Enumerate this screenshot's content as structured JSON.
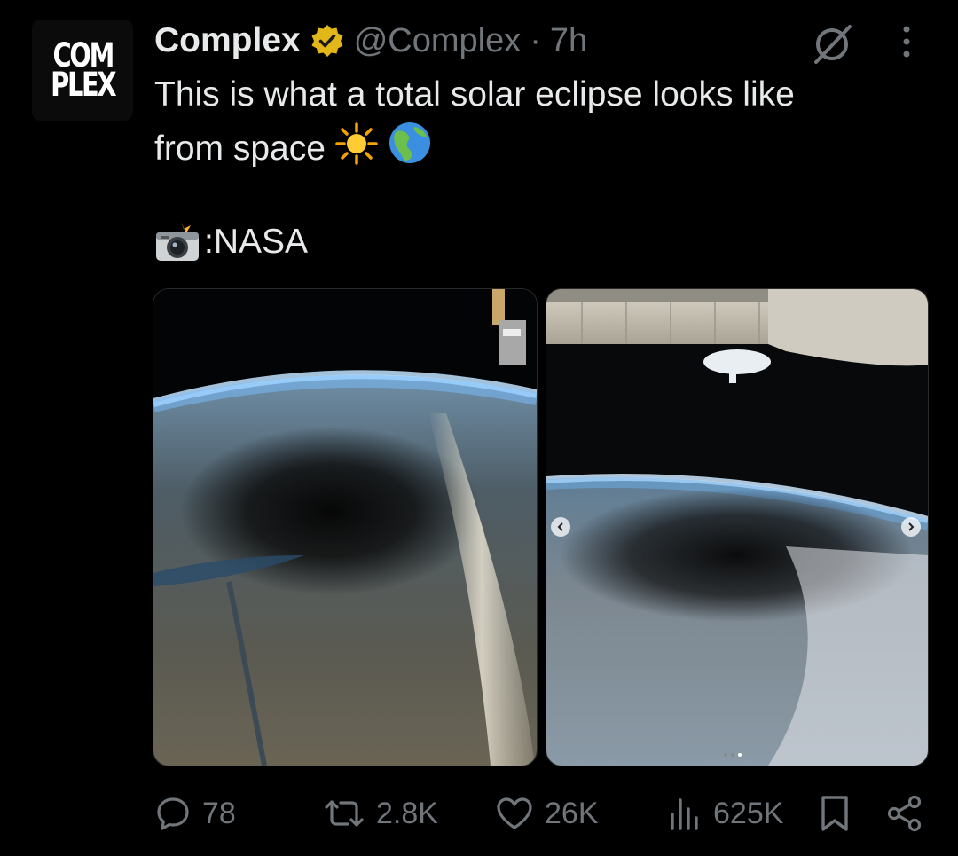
{
  "tweet": {
    "avatar": {
      "line1": "COM",
      "line2": "PLEX"
    },
    "author_name": "Complex",
    "handle": "@Complex",
    "separator": "·",
    "time": "7h",
    "text_line1": "This is what a total solar eclipse looks like",
    "text_line2": "from space",
    "credit_text": ":NASA",
    "emojis": [
      "sun-emoji",
      "globe-americas-emoji",
      "camera-flash-emoji"
    ],
    "media": [
      {
        "name": "eclipse-photo-1"
      },
      {
        "name": "eclipse-photo-2"
      }
    ]
  },
  "actions": {
    "replies": "78",
    "reposts": "2.8K",
    "likes": "26K",
    "views": "625K"
  },
  "colors": {
    "background": "#000000",
    "text": "#e7e9ea",
    "secondary": "#71767b",
    "verified_gold": "#e2b719"
  }
}
